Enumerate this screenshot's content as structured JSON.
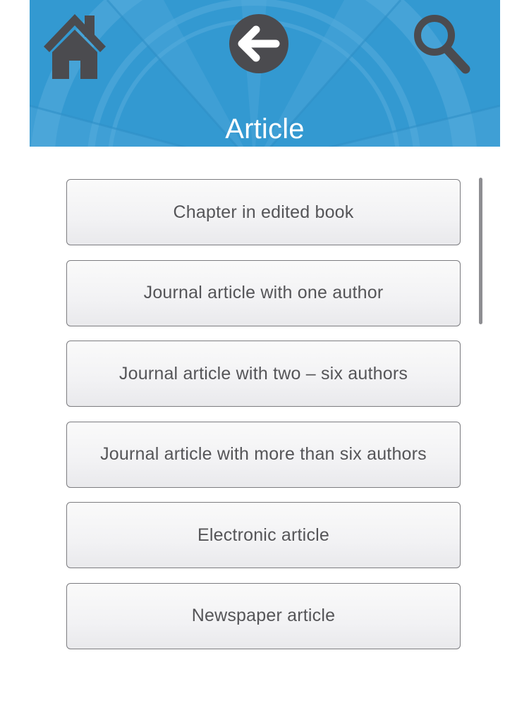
{
  "header": {
    "title": "Article",
    "background_color": "#3399d1",
    "icon_color": "#4b4b4f",
    "home_icon": "home-icon",
    "back_icon": "back-arrow-icon",
    "search_icon": "search-icon"
  },
  "list": {
    "items": [
      {
        "label": "Chapter in edited book"
      },
      {
        "label": "Journal article with one author"
      },
      {
        "label": "Journal article with two – six authors"
      },
      {
        "label": "Journal article with more than six authors"
      },
      {
        "label": "Electronic article"
      },
      {
        "label": "Newspaper article"
      }
    ]
  }
}
